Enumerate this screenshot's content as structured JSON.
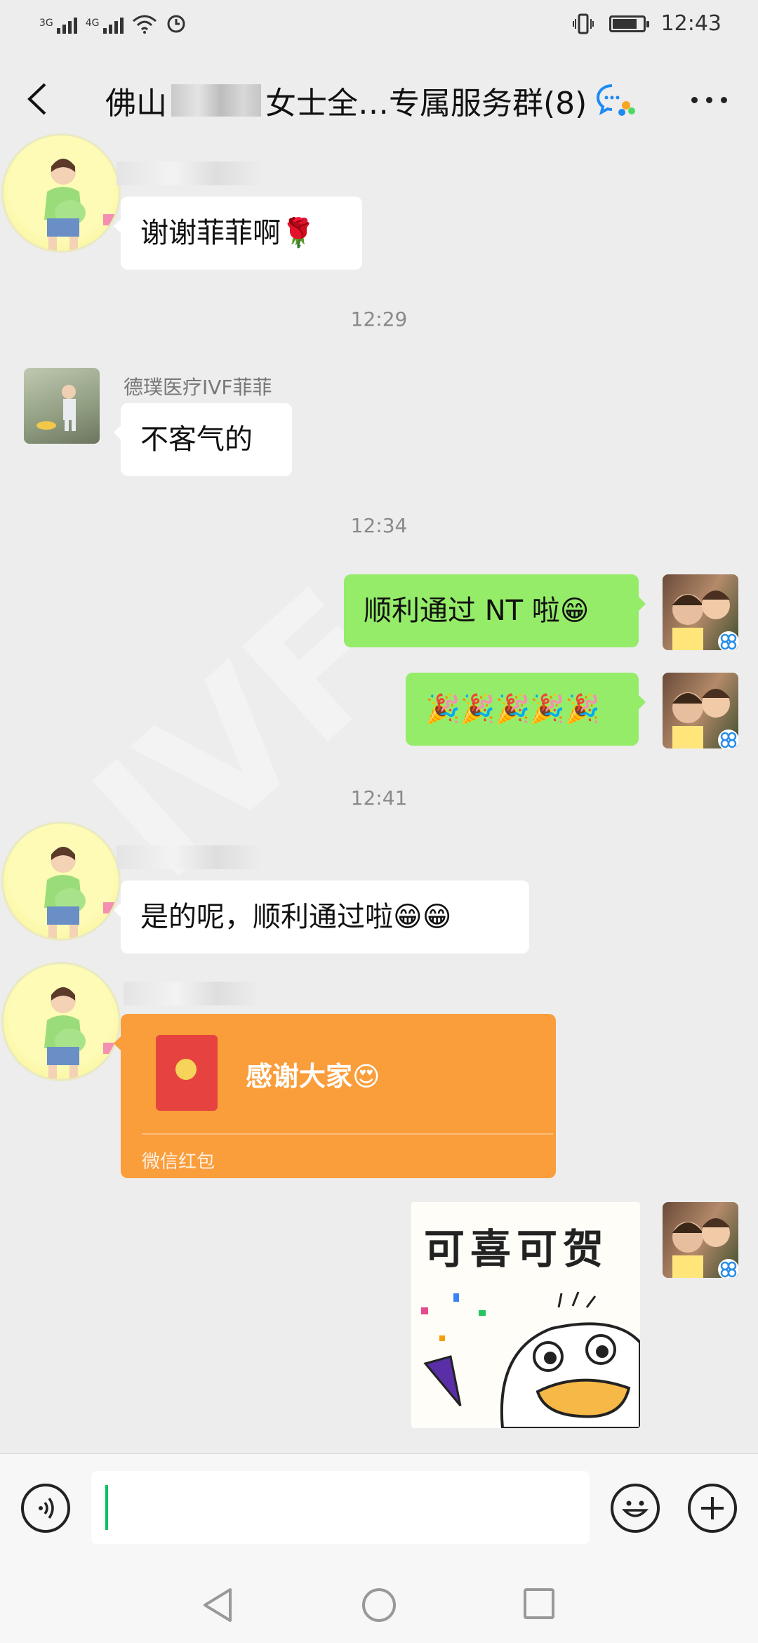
{
  "status_bar": {
    "left": {
      "net1": "3G",
      "net2": "4G"
    },
    "time": "12:43"
  },
  "nav": {
    "title_prefix": "佛山",
    "title_suffix": "女士全…专属服务群(8)",
    "back_icon": "chevron-left-icon",
    "more_icon": "more-dots-icon",
    "group_icon": "group-chat-icon"
  },
  "messages": {
    "m1": {
      "text": "谢谢菲菲啊🌹"
    },
    "t1": "12:29",
    "m2": {
      "sender": "德璞医疗IVF菲菲",
      "text": "不客气的"
    },
    "t2": "12:34",
    "m3": {
      "text": "顺利通过 NT 啦😁"
    },
    "m4": {
      "text": "🎉🎉🎉🎉🎉"
    },
    "t3": "12:41",
    "m5": {
      "text": "是的呢，顺利通过啦😁😁"
    },
    "m6": {
      "title": "感谢大家😍",
      "label": "微信红包"
    },
    "m7": {
      "sticker_text": "可喜可贺"
    }
  },
  "input_bar": {
    "voice_icon": "voice-icon",
    "emoji_icon": "emoji-icon",
    "plus_icon": "plus-icon",
    "value": ""
  },
  "colors": {
    "background": "#ededed",
    "green_bubble": "#95ec69",
    "red_packet": "#fa9d3b",
    "cursor": "#07c160"
  }
}
